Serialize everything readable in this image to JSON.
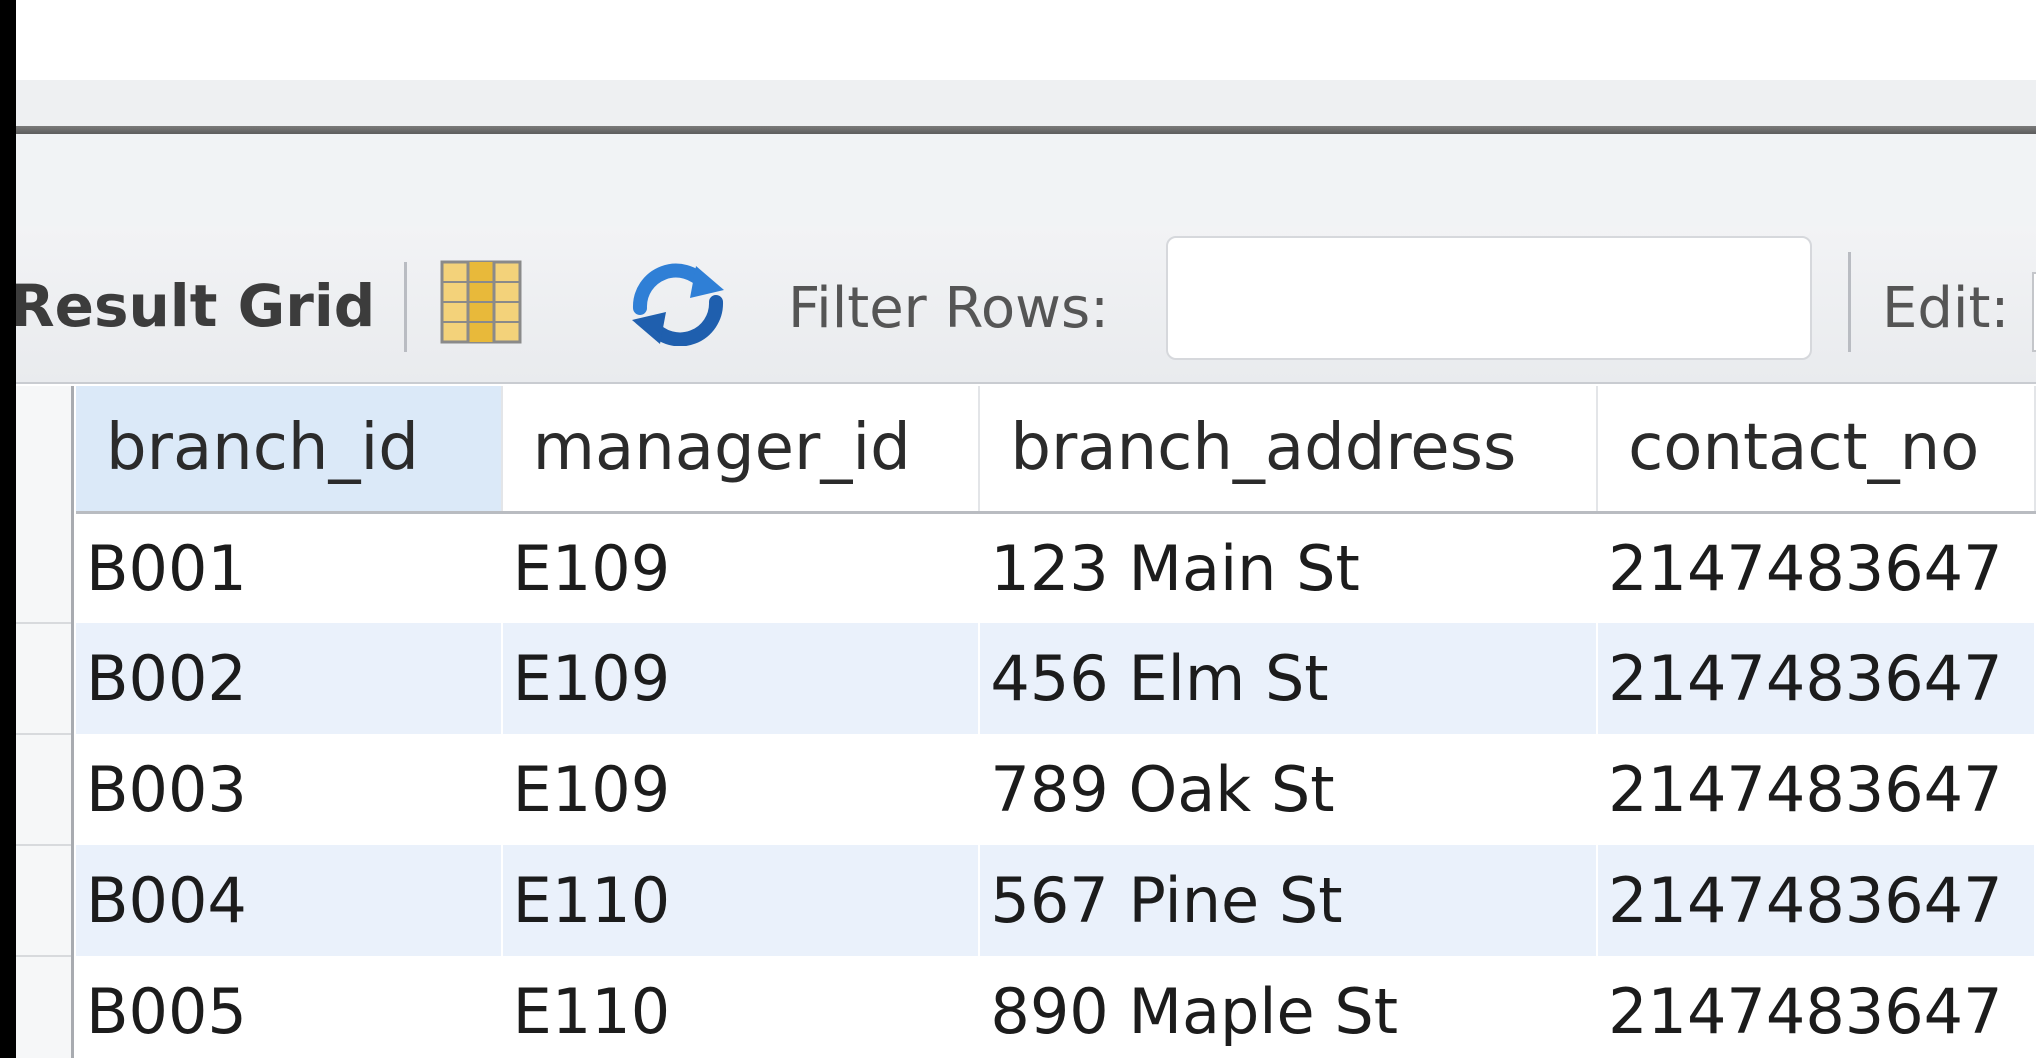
{
  "toolbar": {
    "result_grid_label": "Result Grid",
    "filter_label": "Filter Rows:",
    "filter_value": "",
    "edit_label": "Edit:"
  },
  "icons": {
    "grid": "column-grid-icon",
    "refresh": "refresh-icon"
  },
  "table": {
    "columns": [
      "branch_id",
      "manager_id",
      "branch_address",
      "contact_no"
    ],
    "selected_column": "branch_id",
    "rows": [
      [
        "B001",
        "E109",
        "123 Main St",
        "2147483647"
      ],
      [
        "B002",
        "E109",
        "456 Elm St",
        "2147483647"
      ],
      [
        "B003",
        "E109",
        "789 Oak St",
        "2147483647"
      ],
      [
        "B004",
        "E110",
        "567 Pine St",
        "2147483647"
      ],
      [
        "B005",
        "E110",
        "890 Maple St",
        "2147483647"
      ]
    ]
  },
  "colors": {
    "selected_header": "#dbe9f8",
    "alt_row": "#eaf1fb",
    "refresh_blue": "#2f7fd6",
    "grid_icon_gold": "#e8b93a"
  }
}
